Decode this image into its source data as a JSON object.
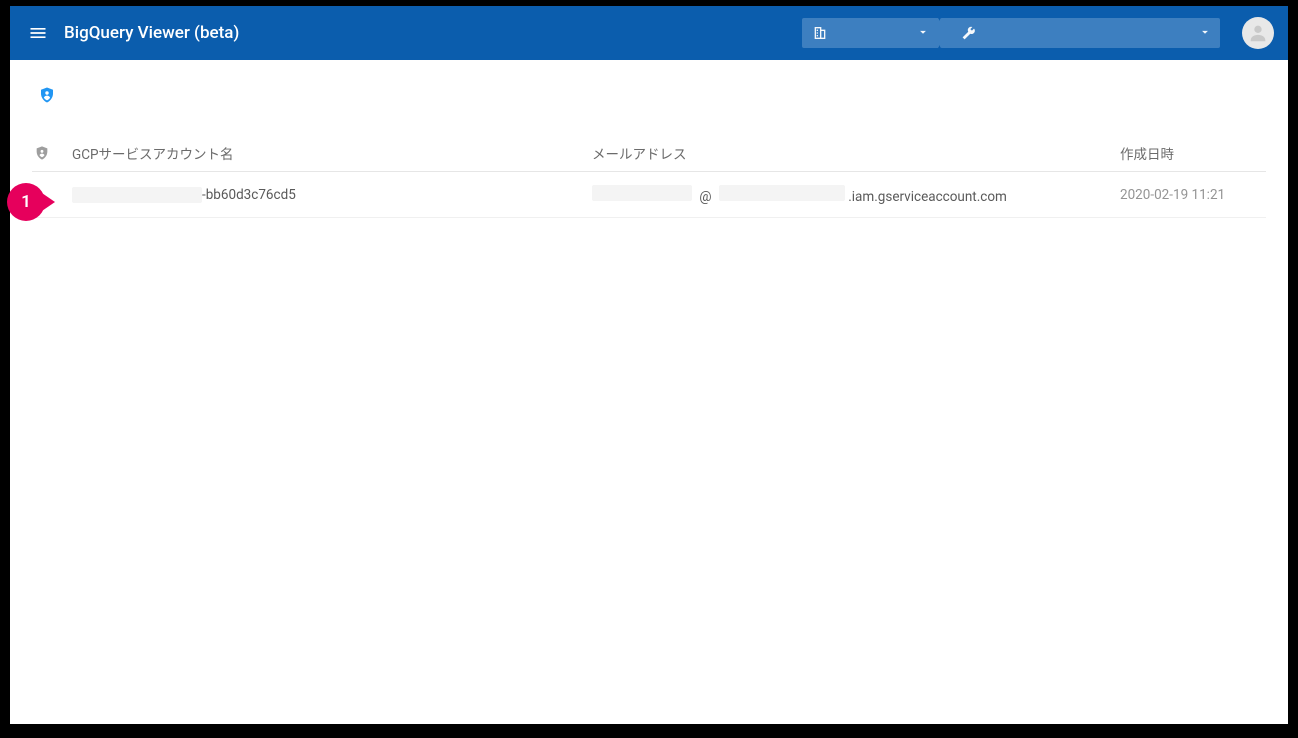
{
  "header": {
    "title": "BigQuery Viewer (beta)"
  },
  "callout": {
    "number": "1"
  },
  "table": {
    "headers": {
      "name": "GCPサービスアカウント名",
      "email": "メールアドレス",
      "created": "作成日時"
    },
    "rows": [
      {
        "name_suffix": "-bb60d3c76cd5",
        "email_at": "@",
        "email_domain_suffix": ".iam.gserviceaccount.com",
        "created": "2020-02-19 11:21"
      }
    ]
  }
}
